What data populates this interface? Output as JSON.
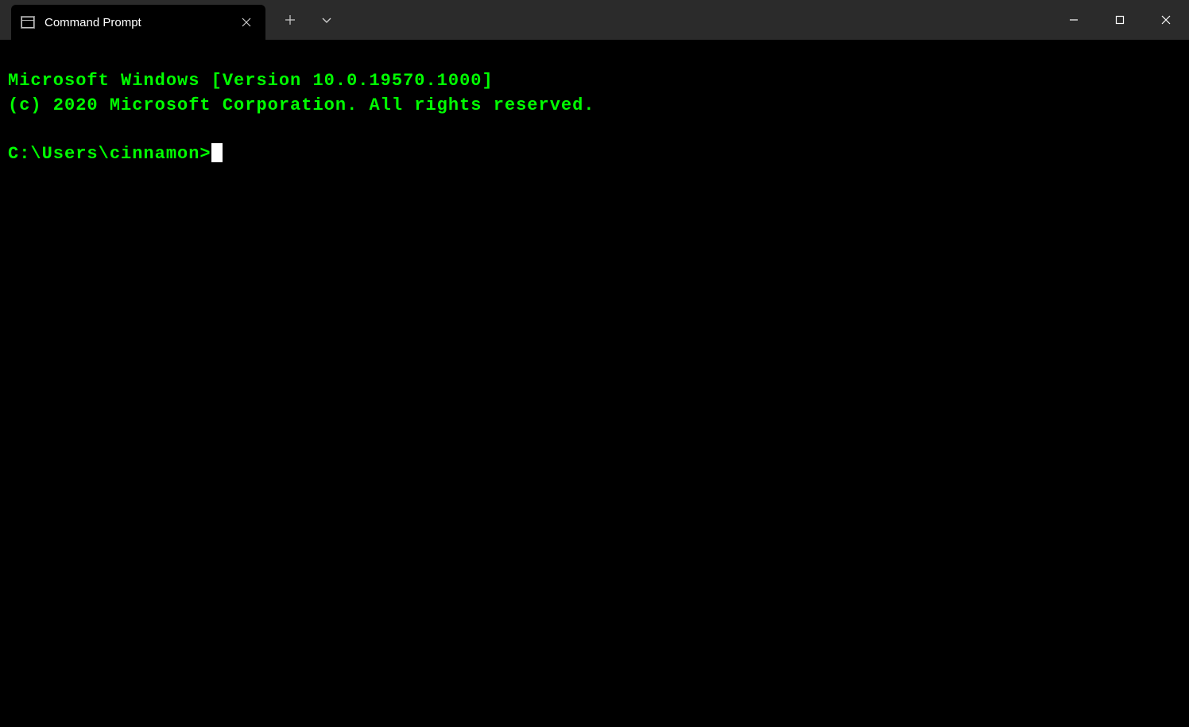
{
  "tab": {
    "title": "Command Prompt"
  },
  "terminal": {
    "line1": "Microsoft Windows [Version 10.0.19570.1000]",
    "line2": "(c) 2020 Microsoft Corporation. All rights reserved.",
    "blank": "",
    "prompt": "C:\\Users\\cinnamon>"
  }
}
